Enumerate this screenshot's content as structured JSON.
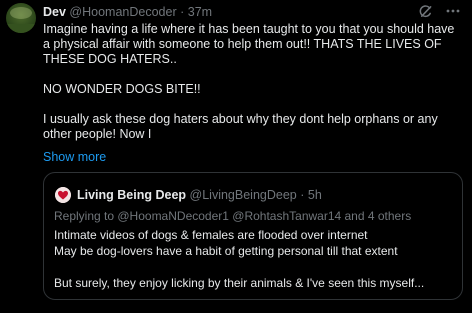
{
  "tweet": {
    "name": "Dev",
    "handle": "@HoomanDecoder",
    "separator": "·",
    "time": "37m",
    "avatar_icon": "avatar-landscape",
    "header_icons": [
      "grok-icon",
      "more-icon"
    ],
    "paragraphs": [
      "Imagine having a life where it has been taught to you that you should have a physical affair with someone to help them out!! THATS THE LIVES OF THESE DOG HATERS..",
      "NO WONDER DOGS BITE!!",
      "I usually ask these dog haters about why they dont help orphans or any other people! Now I"
    ],
    "show_more": "Show more"
  },
  "quote": {
    "name": "Living Being Deep",
    "handle": "@LivingBeingDeep",
    "separator": "·",
    "time": "5h",
    "avatar_icon": "heart-icon",
    "reply_line": "Replying to @HoomaNDecoder1 @RohtashTanwar14 and 4 others",
    "lines": [
      "Intimate videos of dogs & females are flooded over internet",
      "May be dog-lovers have a habit of getting personal till that extent",
      "But surely, they enjoy licking by their animals & I've seen this myself..."
    ]
  },
  "colors": {
    "background": "#000000",
    "text": "#e7e9ea",
    "muted": "#71767b",
    "link": "#1d9bf0",
    "border": "#2f3336",
    "heart": "#c8102e"
  }
}
